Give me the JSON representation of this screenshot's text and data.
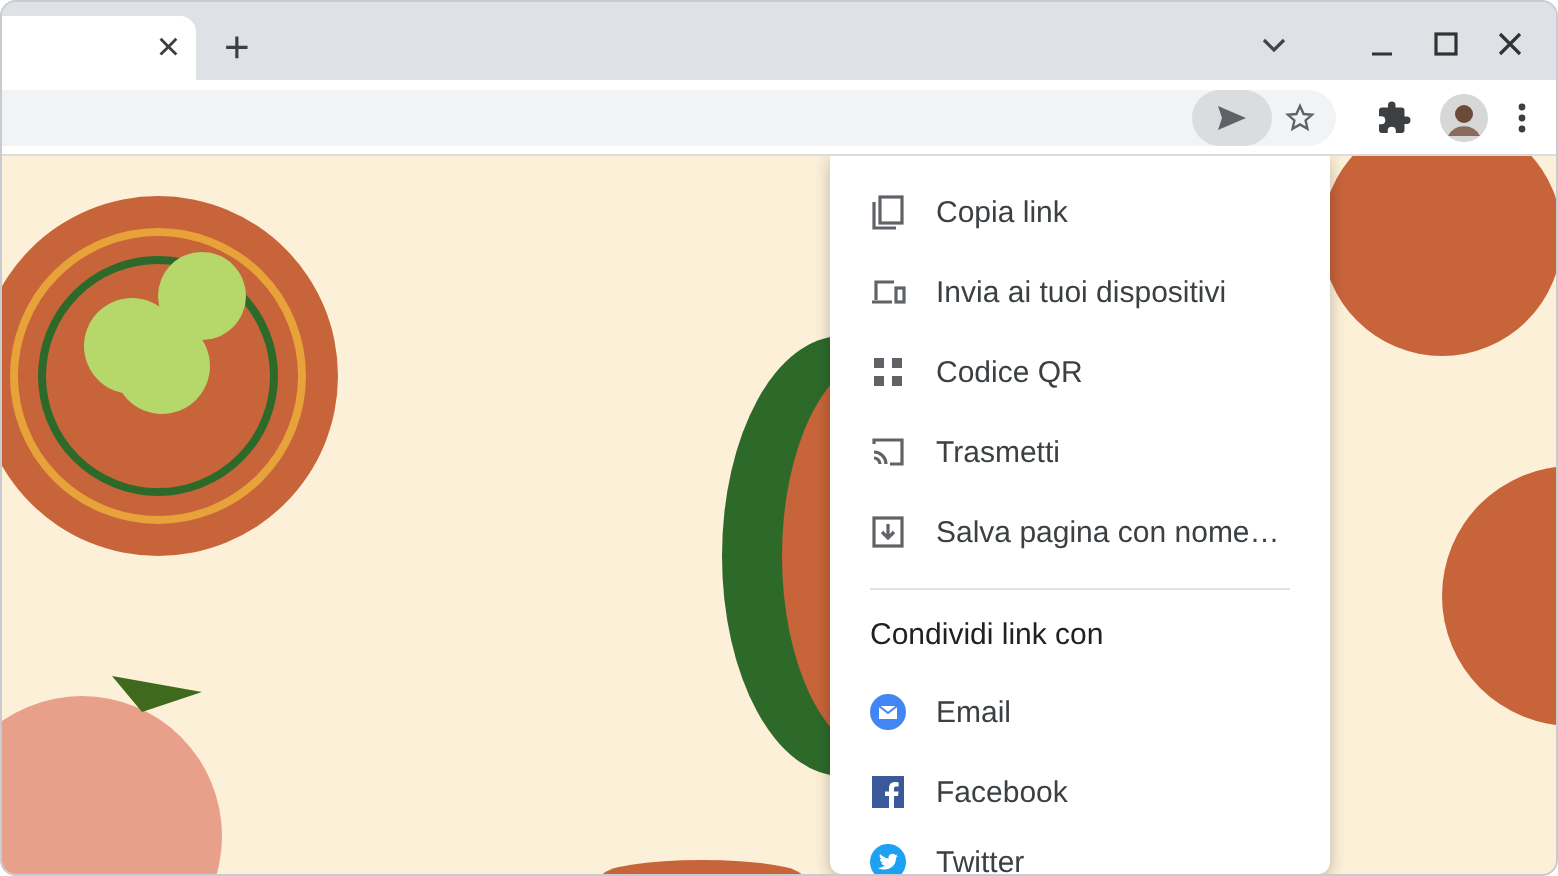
{
  "tab_strip": {
    "tab": {
      "close": "×"
    },
    "new_tab": "+"
  },
  "toolbar": {
    "send_pressed": true
  },
  "share_menu": {
    "items": [
      {
        "kind": "copy",
        "label": "Copia link"
      },
      {
        "kind": "devices",
        "label": "Invia ai tuoi dispositivi"
      },
      {
        "kind": "qr",
        "label": "Codice QR"
      },
      {
        "kind": "cast",
        "label": "Trasmetti"
      },
      {
        "kind": "save",
        "label": "Salva pagina con nome…"
      }
    ],
    "share_heading": "Condividi link con",
    "share_targets": [
      {
        "kind": "email",
        "label": "Email"
      },
      {
        "kind": "facebook",
        "label": "Facebook"
      },
      {
        "kind": "twitter",
        "label": "Twitter"
      }
    ]
  }
}
